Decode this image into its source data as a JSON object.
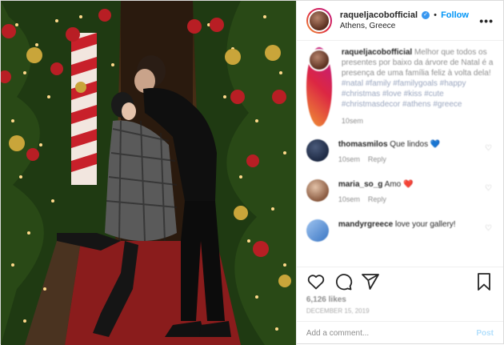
{
  "header": {
    "username": "raqueljacobofficial",
    "follow_label": "Follow",
    "location": "Athens, Greece",
    "more_label": "•••"
  },
  "caption": {
    "username": "raqueljacobofficial",
    "text": "Melhor que todos os presentes por baixo da árvore de Natal é a presença de uma família feliz à volta dela!",
    "hashtags": "#natal #family #familygoals #happy #christmas #love #kiss #cute #christmasdecor #athens #greece",
    "time": "10sem"
  },
  "comments": [
    {
      "username": "thomasmilos",
      "text": "Que lindos",
      "emoji": "💙",
      "time": "10sem",
      "reply": "Reply"
    },
    {
      "username": "maria_so_g",
      "text": "Amo",
      "emoji": "❤️",
      "time": "10sem",
      "reply": "Reply"
    },
    {
      "username": "mandyrgreece",
      "text": "love your gallery!",
      "emoji": "",
      "time": "",
      "reply": ""
    }
  ],
  "likes": "6,126 likes",
  "date": "December 15, 2019",
  "add_comment": {
    "placeholder": "Add a comment...",
    "post_label": "Post"
  },
  "colors": {
    "accent": "#0095f6",
    "verified": "#3897f0",
    "post_disabled": "#b2dffc"
  },
  "icons": [
    "verified-badge-icon",
    "heart-icon",
    "comment-icon",
    "share-icon",
    "bookmark-icon",
    "more-options-icon"
  ]
}
